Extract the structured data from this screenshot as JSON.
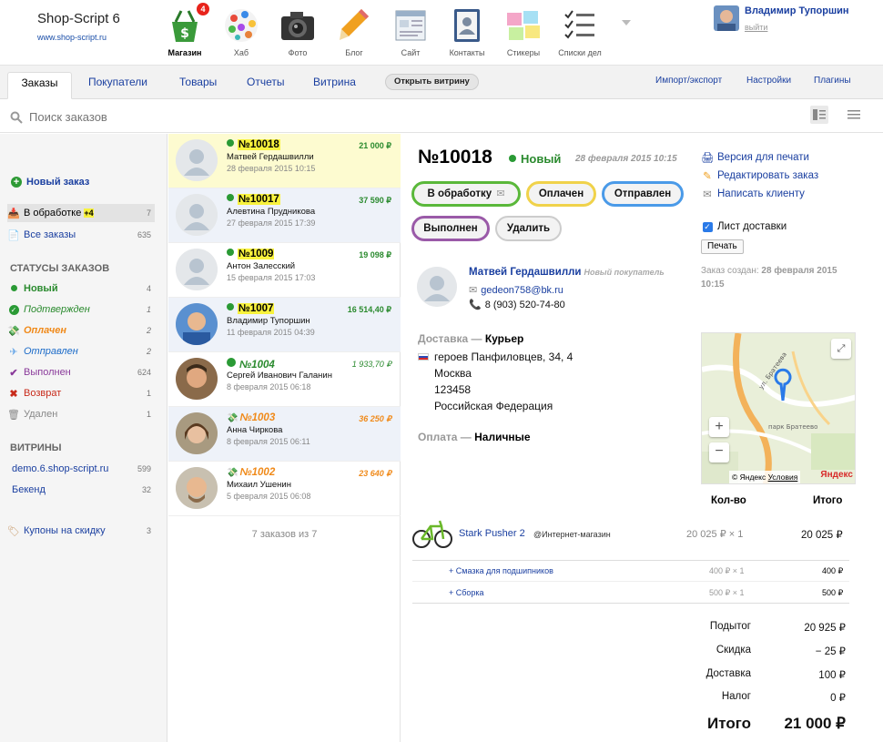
{
  "brand": {
    "name": "Shop-Script 6",
    "url": "www.shop-script.ru"
  },
  "apps": [
    {
      "label": "Магазин",
      "icon": "shop-basket-icon",
      "badge": "4",
      "active": true
    },
    {
      "label": "Хаб",
      "icon": "hub-icon"
    },
    {
      "label": "Фото",
      "icon": "camera-icon"
    },
    {
      "label": "Блог",
      "icon": "pencil-icon"
    },
    {
      "label": "Сайт",
      "icon": "site-icon"
    },
    {
      "label": "Контакты",
      "icon": "contacts-icon"
    },
    {
      "label": "Стикеры",
      "icon": "stickers-icon"
    },
    {
      "label": "Списки дел",
      "icon": "checklist-icon"
    }
  ],
  "user": {
    "name": "Владимир Тупоршин",
    "logout": "выйти"
  },
  "tabs": [
    {
      "label": "Заказы",
      "active": true
    },
    {
      "label": "Покупатели"
    },
    {
      "label": "Товары"
    },
    {
      "label": "Отчеты"
    },
    {
      "label": "Витрина"
    }
  ],
  "open_storefront": "Открыть витрину",
  "tab_right": [
    "Импорт/экспорт",
    "Настройки",
    "Плагины"
  ],
  "search": {
    "placeholder": "Поиск заказов"
  },
  "sidebar": {
    "new_order": "Новый заказ",
    "processing": {
      "label": "В обработке",
      "extra": "+4",
      "count": "7"
    },
    "all_orders": {
      "label": "Все заказы",
      "count": "635"
    },
    "statuses_title": "СТАТУСЫ ЗАКАЗОВ",
    "statuses": [
      {
        "label": "Новый",
        "count": "4",
        "color": "#2a8a2e"
      },
      {
        "label": "Подтвержден",
        "count": "1",
        "color": "#2a8a2e"
      },
      {
        "label": "Оплачен",
        "count": "2",
        "color": "#f08a1a"
      },
      {
        "label": "Отправлен",
        "count": "2",
        "color": "#1a6ac8"
      },
      {
        "label": "Выполнен",
        "count": "624",
        "color": "#8a3a9a"
      },
      {
        "label": "Возврат",
        "count": "1",
        "color": "#c82a1a"
      },
      {
        "label": "Удален",
        "count": "1",
        "color": "#999999"
      }
    ],
    "storefronts_title": "ВИТРИНЫ",
    "storefronts": [
      {
        "label": "demo.6.shop-script.ru",
        "count": "599"
      },
      {
        "label": "Бекенд",
        "count": "32"
      }
    ],
    "coupons": {
      "label": "Купоны на скидку",
      "count": "3"
    }
  },
  "orders": [
    {
      "num": "№10018",
      "amount": "21 000 ₽",
      "customer": "Матвей Гердашвилли",
      "date": "28 февраля 2015 10:15",
      "status": "new"
    },
    {
      "num": "№10017",
      "amount": "37 590 ₽",
      "customer": "Алевтина Прудникова",
      "date": "27 февраля 2015 17:39",
      "status": "new"
    },
    {
      "num": "№1009",
      "amount": "19 098 ₽",
      "customer": "Антон Залесский",
      "date": "15 февраля 2015 17:03",
      "status": "new"
    },
    {
      "num": "№1007",
      "amount": "16 514,40 ₽",
      "customer": "Владимир Тупоршин",
      "date": "11 февраля 2015 04:39",
      "status": "new"
    },
    {
      "num": "№1004",
      "amount": "1 933,70 ₽",
      "customer": "Сергей Иванович Галанин",
      "date": "8 февраля 2015 06:18",
      "status": "confirmed"
    },
    {
      "num": "№1003",
      "amount": "36 250 ₽",
      "customer": "Анна Чиркова",
      "date": "8 февраля 2015 06:11",
      "status": "paid"
    },
    {
      "num": "№1002",
      "amount": "23 640 ₽",
      "customer": "Михаил Ушенин",
      "date": "5 февраля 2015 06:08",
      "status": "paid"
    }
  ],
  "orders_count": "7 заказов из 7",
  "order": {
    "num": "№10018",
    "status": "Новый",
    "date": "28 февраля 2015 10:15",
    "actions": [
      "В обработку",
      "Оплачен",
      "Отправлен",
      "Выполнен",
      "Удалить"
    ],
    "customer": {
      "name": "Матвей Гердашвилли",
      "tag": "Новый покупатель",
      "email": "gedeon758@bk.ru",
      "phone": "8 (903) 520-74-80"
    },
    "delivery_label": "Доставка",
    "delivery_method": "Курьер",
    "address": [
      "героев Панфиловцев, 34, 4",
      "Москва",
      "123458",
      "Российская Федерация"
    ],
    "payment_label": "Оплата",
    "payment_method": "Наличные",
    "side": {
      "print_version": "Версия для печати",
      "edit_order": "Редактировать заказ",
      "write_client": "Написать клиенту",
      "delivery_sheet": "Лист доставки",
      "print_btn": "Печать",
      "created_label": "Заказ создан:",
      "created_date": "28 февраля 2015",
      "created_time": "10:15"
    },
    "map": {
      "street": "ул. Братеева",
      "park": "парк Братеево",
      "attribution": "© Яндекс",
      "terms": "Условия",
      "logo": "Яндекс"
    },
    "table": {
      "qty_header": "Кол-во",
      "total_header": "Итого",
      "items": [
        {
          "name": "Stark Pusher 2",
          "store": "@Интернет-магазин",
          "price": "20 025 ₽ × 1",
          "total": "20 025 ₽"
        },
        {
          "name": "+ Смазка для подшипников",
          "price": "400 ₽ × 1",
          "total": "400 ₽"
        },
        {
          "name": "+ Сборка",
          "price": "500 ₽ × 1",
          "total": "500 ₽"
        }
      ],
      "totals": [
        {
          "label": "Подытог",
          "value": "20 925 ₽"
        },
        {
          "label": "Скидка",
          "value": "− 25 ₽"
        },
        {
          "label": "Доставка",
          "value": "100 ₽"
        },
        {
          "label": "Налог",
          "value": "0 ₽"
        }
      ],
      "grand_label": "Итого",
      "grand_value": "21 000 ₽"
    }
  },
  "colors": {
    "link": "#1a3fa0",
    "new": "#2a8a2e",
    "paid": "#f08a1a",
    "highlight": "#f8f23d",
    "selected_row": "#fdfbd0"
  }
}
